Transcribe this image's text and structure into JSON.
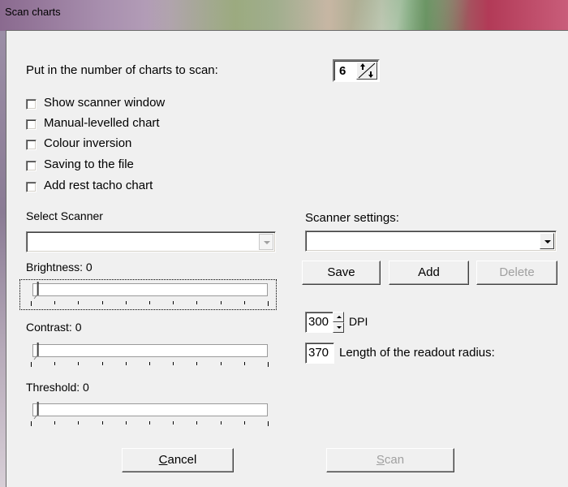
{
  "window": {
    "title": "Scan charts"
  },
  "charts_count": {
    "label": "Put in the number of charts to scan:",
    "value": "6"
  },
  "options": [
    {
      "label": "Show scanner window",
      "checked": false
    },
    {
      "label": "Manual-levelled chart",
      "checked": false
    },
    {
      "label": "Colour inversion",
      "checked": false
    },
    {
      "label": "Saving to the file",
      "checked": false
    },
    {
      "label": "Add rest tacho chart",
      "checked": false
    }
  ],
  "scanner": {
    "label": "Select Scanner",
    "value": ""
  },
  "scanner_settings": {
    "label": "Scanner settings:",
    "value": ""
  },
  "settings_buttons": {
    "save": "Save",
    "add": "Add",
    "delete": "Delete"
  },
  "sliders": {
    "brightness": {
      "label": "Brightness: 0",
      "value": 0
    },
    "contrast": {
      "label": "Contrast: 0",
      "value": 0
    },
    "threshold": {
      "label": "Threshold: 0",
      "value": 0
    }
  },
  "dpi": {
    "value": "300",
    "label": "DPI"
  },
  "radius": {
    "value": "370",
    "label": "Length of the readout radius:"
  },
  "footer": {
    "cancel_prefix": "C",
    "cancel_rest": "ancel",
    "scan_prefix": "S",
    "scan_rest": "can"
  },
  "colors": {
    "disabled_text": "#a0a0a0",
    "dialog_bg": "#f0f0f0"
  }
}
